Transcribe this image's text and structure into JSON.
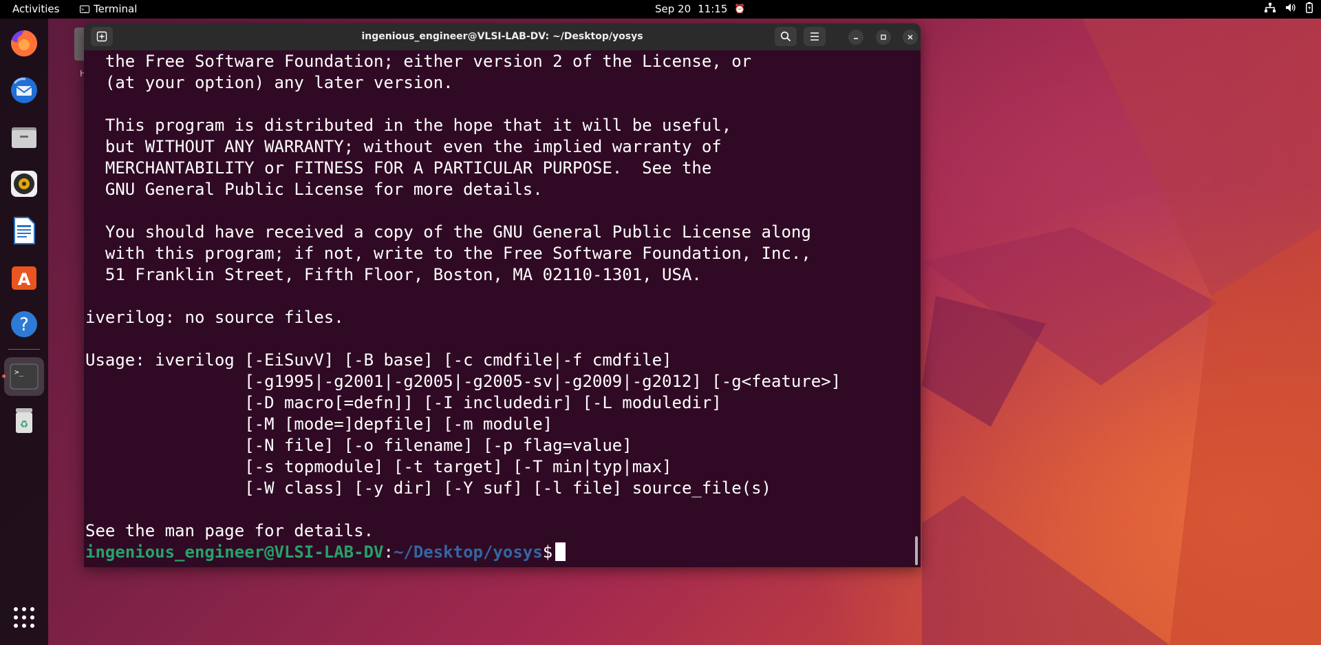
{
  "topbar": {
    "activities": "Activities",
    "app_name": "Terminal",
    "date": "Sep 20",
    "time": "11:15"
  },
  "dock": {
    "items": [
      {
        "name": "firefox-icon"
      },
      {
        "name": "thunderbird-icon"
      },
      {
        "name": "files-icon"
      },
      {
        "name": "rhythmbox-icon"
      },
      {
        "name": "libreoffice-writer-icon"
      },
      {
        "name": "app-center-icon"
      },
      {
        "name": "help-icon"
      },
      {
        "name": "terminal-icon"
      },
      {
        "name": "trash-icon"
      },
      {
        "name": "show-apps-icon"
      }
    ]
  },
  "desktop": {
    "icon_label": "H"
  },
  "terminal": {
    "title": "ingenious_engineer@VLSI-LAB-DV: ~/Desktop/yosys",
    "lines": [
      "  the Free Software Foundation; either version 2 of the License, or",
      "  (at your option) any later version.",
      "",
      "  This program is distributed in the hope that it will be useful,",
      "  but WITHOUT ANY WARRANTY; without even the implied warranty of",
      "  MERCHANTABILITY or FITNESS FOR A PARTICULAR PURPOSE.  See the",
      "  GNU General Public License for more details.",
      "",
      "  You should have received a copy of the GNU General Public License along",
      "  with this program; if not, write to the Free Software Foundation, Inc.,",
      "  51 Franklin Street, Fifth Floor, Boston, MA 02110-1301, USA.",
      "",
      "iverilog: no source files.",
      "",
      "Usage: iverilog [-EiSuvV] [-B base] [-c cmdfile|-f cmdfile]",
      "                [-g1995|-g2001|-g2005|-g2005-sv|-g2009|-g2012] [-g<feature>]",
      "                [-D macro[=defn]] [-I includedir] [-L moduledir]",
      "                [-M [mode=]depfile] [-m module]",
      "                [-N file] [-o filename] [-p flag=value]",
      "                [-s topmodule] [-t target] [-T min|typ|max]",
      "                [-W class] [-y dir] [-Y suf] [-l file] source_file(s)",
      "",
      "See the man page for details."
    ],
    "prompt_user": "ingenious_engineer@VLSI-LAB-DV",
    "prompt_sep": ":",
    "prompt_path": "~/Desktop/yosys",
    "prompt_symbol": "$"
  },
  "colors": {
    "terminal_bg": "#300a24",
    "prompt_user": "#26a269",
    "prompt_path": "#3465a4",
    "running_indicator": "#e95420"
  }
}
